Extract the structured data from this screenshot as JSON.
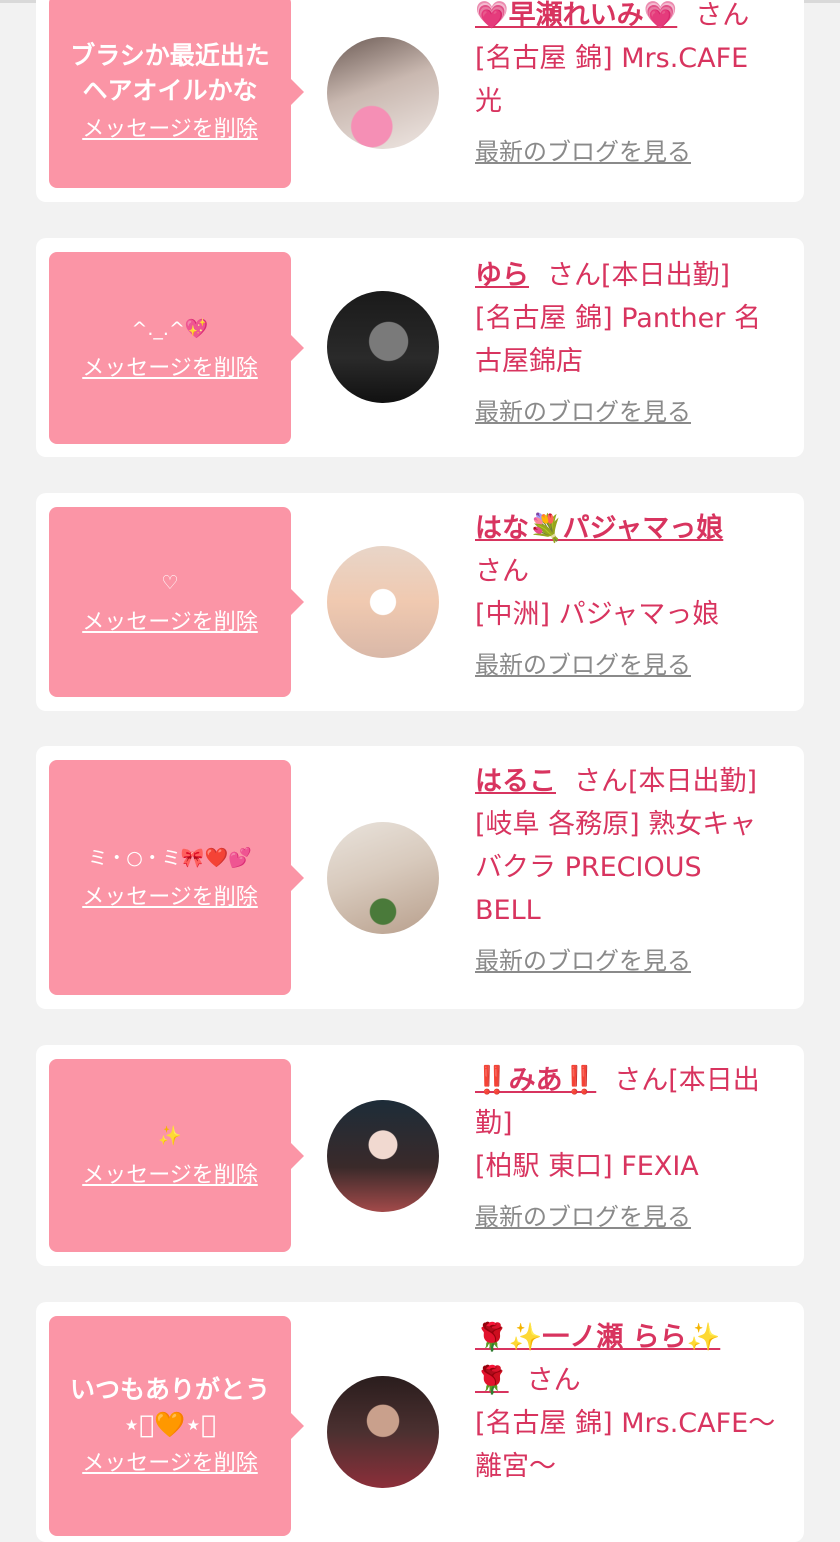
{
  "cards": [
    {
      "message": "ブラシか最近出た\nヘアオイルかな",
      "delete_label": "メッセージを削除",
      "name": "💗早瀬れいみ💗",
      "honorific": "さん",
      "shop": "[名古屋 錦] Mrs.CAFE\n光",
      "blog_label": "最新のブログを見る"
    },
    {
      "message": "^._.^💖",
      "delete_label": "メッセージを削除",
      "name": "ゆら",
      "honorific": "さん[本日出勤]",
      "shop": "[名古屋 錦] Panther 名\n古屋錦店",
      "blog_label": "最新のブログを見る"
    },
    {
      "message": "♡",
      "delete_label": "メッセージを削除",
      "name": "はな💐パジャマっ娘",
      "honorific": "さん",
      "shop": "[中洲] パジャマっ娘",
      "blog_label": "最新のブログを見る"
    },
    {
      "message": "ミ・○・ミ🎀❤️💕",
      "delete_label": "メッセージを削除",
      "name": "はるこ",
      "honorific": "さん[本日出勤]",
      "shop": "[岐阜 各務原]  熟女キャ\nバクラ PRECIOUS\nBELL",
      "blog_label": "最新のブログを見る"
    },
    {
      "message": "✨",
      "delete_label": "メッセージを削除",
      "name": "‼️みあ‼️",
      "honorific": "さん[本日出\n勤]",
      "shop": "[柏駅 東口] FEXIA",
      "blog_label": "最新のブログを見る"
    },
    {
      "message": "いつもありがとう\n⋆͛🧡⋆͛",
      "delete_label": "メッセージを削除",
      "name": "🌹✨一ノ瀬 らら✨\n🌹",
      "honorific": "さん",
      "shop": "[名古屋 錦] Mrs.CAFE〜\n離宮〜",
      "blog_label": "最新のブログを見る"
    }
  ],
  "colors": {
    "accent": "#d8345f",
    "bubble": "#fb95a6",
    "background": "#f2f2f2"
  }
}
